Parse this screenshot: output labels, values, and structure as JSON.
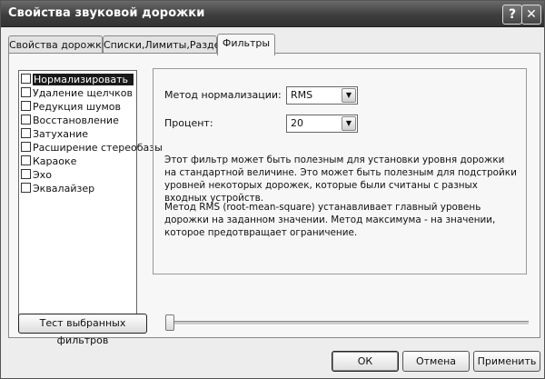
{
  "window": {
    "title": "Свойства звуковой дорожки",
    "help_glyph": "?",
    "close_glyph": "✕"
  },
  "tabs": [
    {
      "label": "Свойства дорожки"
    },
    {
      "label": "Списки,Лимиты,Раздел"
    },
    {
      "label": "Фильтры"
    }
  ],
  "active_tab": "Фильтры",
  "filters": {
    "selected": "Нормализировать",
    "items": [
      {
        "label": "Нормализировать",
        "checked": false
      },
      {
        "label": "Удаление щелчков",
        "checked": false
      },
      {
        "label": "Редукция шумов",
        "checked": false
      },
      {
        "label": "Восстановление",
        "checked": false
      },
      {
        "label": "Затухание",
        "checked": false
      },
      {
        "label": "Расширение стереобазы",
        "checked": false
      },
      {
        "label": "Караоке",
        "checked": false
      },
      {
        "label": "Эхо",
        "checked": false
      },
      {
        "label": "Эквалайзер",
        "checked": false
      }
    ]
  },
  "settings": {
    "method_label": "Метод нормализации:",
    "method_value": "RMS",
    "percent_label": "Процент:",
    "percent_value": "20",
    "description1": "Этот фильтр может быть полезным для установки уровня дорожки на стандартной величине. Это может быть полезным для подстройки уровней некоторых дорожек, которые были считаны с разных входных устройств.",
    "description2": "Метод RMS (root-mean-square) устанавливает главный уровень дорожки на заданном значении. Метод максимума - на значении, которое предотвращает ограничение."
  },
  "test_button_label": "Тест выбранных фильтров",
  "slider": {
    "value": 0
  },
  "buttons": {
    "ok": "ОК",
    "cancel": "Отмена",
    "apply": "Применить"
  }
}
